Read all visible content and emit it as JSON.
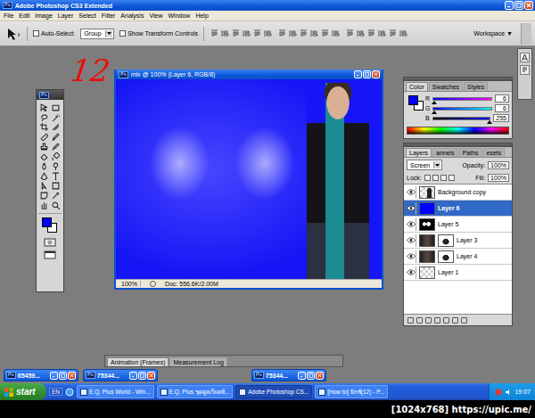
{
  "window": {
    "title": "Adobe Photoshop CS3 Extended",
    "icon": "Ps"
  },
  "menu": [
    "File",
    "Edit",
    "Image",
    "Layer",
    "Select",
    "Filter",
    "Analysis",
    "View",
    "Window",
    "Help"
  ],
  "options_bar": {
    "auto_select": {
      "label": "Auto-Select:",
      "checked": false
    },
    "auto_select_target": "Group",
    "show_transform": {
      "label": "Show Transform Controls",
      "checked": false
    },
    "workspace": "Workspace ▼"
  },
  "annotation": "12",
  "tools": {
    "header": "Ps"
  },
  "document": {
    "title": "mix @ 100% (Layer 6, RGB/8)",
    "icon": "Ps",
    "zoom": "100%",
    "info": "Doc: 556.6K/2.00M"
  },
  "color_panel": {
    "tabs": [
      {
        "label": "Color",
        "selected": true
      },
      {
        "label": "Swatches",
        "selected": false
      },
      {
        "label": "Styles",
        "selected": false
      }
    ],
    "channels": [
      {
        "name": "R",
        "value": "6",
        "level": 0.02
      },
      {
        "name": "G",
        "value": "6",
        "level": 0.02
      },
      {
        "name": "B",
        "value": "255",
        "level": 1
      }
    ]
  },
  "layers_panel": {
    "tabs": [
      {
        "label": "Layers",
        "selected": true
      },
      {
        "label": "annels",
        "selected": false
      },
      {
        "label": "Paths",
        "selected": false
      },
      {
        "label": "esets",
        "selected": false
      }
    ],
    "blend_mode": "Screen",
    "opacity_label": "Opacity:",
    "opacity": "100%",
    "lock_label": "Lock:",
    "fill_label": "Fill:",
    "fill": "100%",
    "layers": [
      {
        "name": "Background copy",
        "visible": true,
        "selected": false,
        "kind": "figure"
      },
      {
        "name": "Layer 6",
        "visible": true,
        "selected": true,
        "kind": "fill"
      },
      {
        "name": "Layer 5",
        "visible": true,
        "selected": false,
        "kind": "mask"
      },
      {
        "name": "Layer 3",
        "visible": true,
        "selected": false,
        "kind": "masked"
      },
      {
        "name": "Layer 4",
        "visible": true,
        "selected": false,
        "kind": "masked"
      },
      {
        "name": "Layer 1",
        "visible": true,
        "selected": false,
        "kind": "empty"
      }
    ]
  },
  "bottom_panel": {
    "tabs": [
      {
        "label": "Animation (Frames)",
        "selected": true
      },
      {
        "label": "Measurement Log",
        "selected": false
      }
    ]
  },
  "minimized_windows": [
    {
      "title": "65459..."
    },
    {
      "title": "75344..."
    },
    {
      "title": "75344..."
    }
  ],
  "taskbar": {
    "start": "start",
    "language": "EN",
    "buttons": [
      {
        "label": "E.Q. Plus World - Win...",
        "selected": false
      },
      {
        "label": "E.Q. Plus ชุดคูลเรียดท์...",
        "selected": false
      },
      {
        "label": "Adobe Photoshop CS...",
        "selected": true
      },
      {
        "label": "[How to] มิกซ์(12) - P...",
        "selected": false
      }
    ],
    "clock": "19:07"
  },
  "watermark": "[1024x768] https://upic.me/"
}
